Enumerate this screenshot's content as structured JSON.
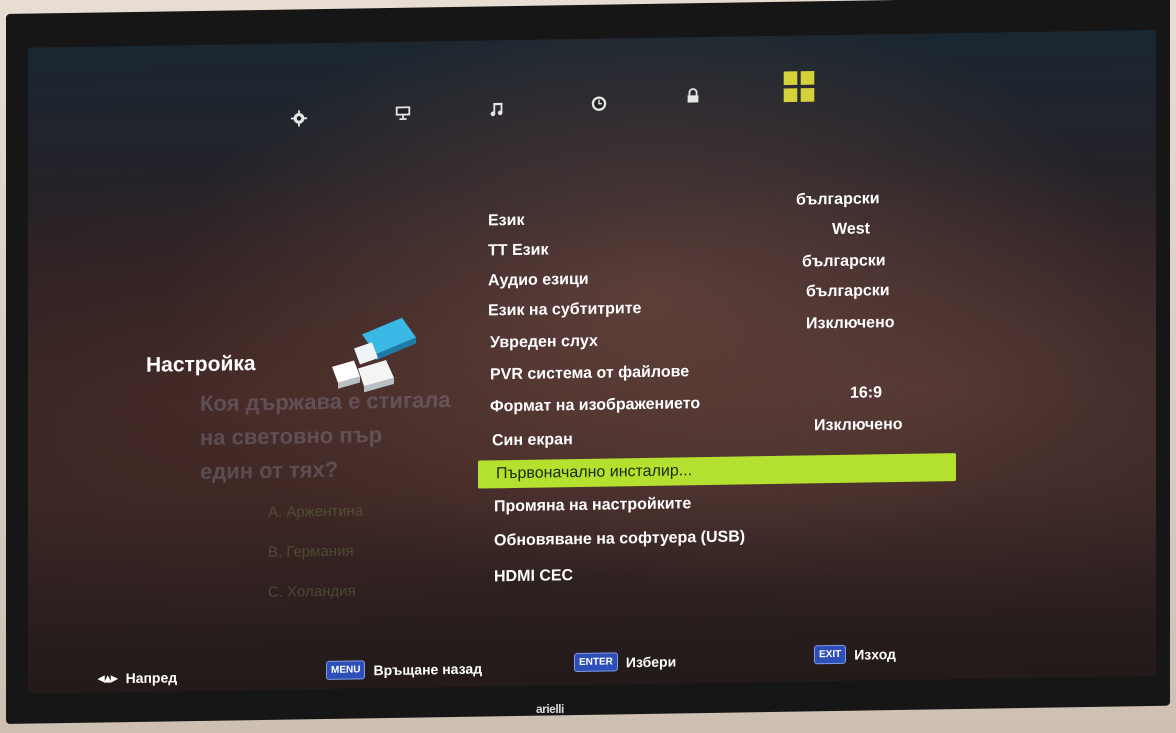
{
  "section": {
    "title": "Настройка",
    "graphic_icon": "settings-blocks-icon"
  },
  "top_tabs": [
    {
      "icon": "gear-icon",
      "active": false
    },
    {
      "icon": "monitor-icon",
      "active": false
    },
    {
      "icon": "music-note-icon",
      "active": false
    },
    {
      "icon": "clock-icon",
      "active": false
    },
    {
      "icon": "lock-icon",
      "active": false
    },
    {
      "icon": "grid-setup-icon",
      "active": true
    }
  ],
  "menu": {
    "items": [
      {
        "label": "Език",
        "value": "български"
      },
      {
        "label": "ТТ Език",
        "value": "West"
      },
      {
        "label": "Аудио езици",
        "value": "български"
      },
      {
        "label": "Език на субтитрите",
        "value": "български"
      },
      {
        "label": "Увреден слух",
        "value": "Изключено"
      },
      {
        "label": "PVR система от файлове",
        "value": ""
      },
      {
        "label": "Формат на изображението",
        "value": "16:9"
      },
      {
        "label": "Син екран",
        "value": "Изключено"
      },
      {
        "label": "Първоначално инсталир...",
        "value": "",
        "selected": true
      },
      {
        "label": "Промяна на настройките",
        "value": ""
      },
      {
        "label": "Обновяване на софтуера (USB)",
        "value": ""
      },
      {
        "label": "HDMI CEC",
        "value": ""
      }
    ]
  },
  "background_quiz": {
    "question_line1": "Коя държава е стигала",
    "question_line2": "на световно пър",
    "question_line3": "един от тях?",
    "option_a": "A. Аржентина",
    "option_b": "B. Германия",
    "option_c": "C. Холандия"
  },
  "bottom_bar": {
    "navigate_label": "Напред",
    "menu_key": "MENU",
    "menu_label": "Връщане назад",
    "enter_key": "ENTER",
    "enter_label": "Избери",
    "exit_key": "EXIT",
    "exit_label": "Изход"
  },
  "brand": "arielli",
  "colors": {
    "selection": "#b4e030",
    "active_tab": "#d4d23a",
    "key_badge": "#2e4fb8"
  }
}
